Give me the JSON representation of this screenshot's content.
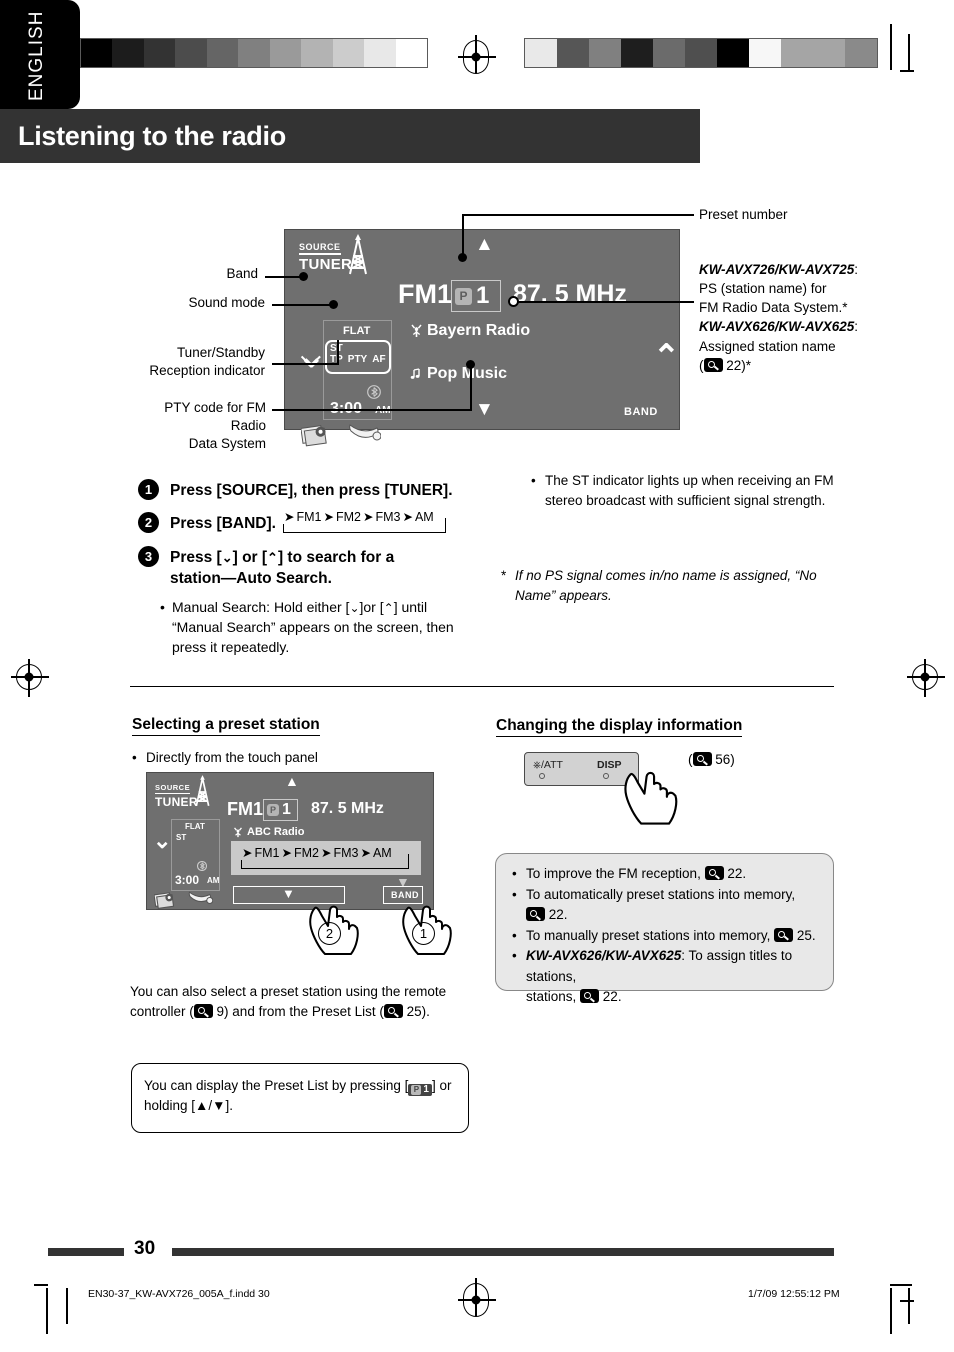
{
  "page": {
    "language_tab": "ENGLISH",
    "title": "Listening to the radio",
    "page_number": "30",
    "footer_file": "EN30-37_KW-AVX726_005A_f.indd   30",
    "footer_date": "1/7/09   12:55:12 PM"
  },
  "display_panel_main": {
    "source_top": "SOURCE",
    "source_bottom": "TUNER",
    "band": "FM1",
    "preset_letter": "P",
    "preset_number": "1",
    "frequency": "87. 5 MHz",
    "ps_name": "Bayern Radio",
    "pty_name": "Pop Music",
    "sound_mode": "FLAT",
    "st_indicator": "ST",
    "tp_indicator": "TP",
    "pty_indicator": "PTY",
    "af_indicator": "AF",
    "clock_time": "3:00",
    "clock_ampm": "AM",
    "band_button": "BAND"
  },
  "callouts_left": [
    {
      "label": "Band"
    },
    {
      "label": "Sound mode"
    },
    {
      "label": "Tuner/Standby\nReception indicator"
    },
    {
      "label": "PTY code for FM Radio\nData System"
    }
  ],
  "callouts_right": {
    "preset_number": "Preset number",
    "ps_model_a": "KW-AVX726/KW-AVX725",
    "ps_desc_a_line1": "PS (station name) for",
    "ps_desc_a_line2": "FM Radio Data System.*",
    "ps_model_b": "KW-AVX626/KW-AVX625",
    "ps_desc_b": "Assigned station name",
    "ps_ref_open": "(",
    "ps_ref_page": "22)*"
  },
  "steps": [
    {
      "num": "1",
      "text": "Press [SOURCE], then press [TUNER]."
    },
    {
      "num": "2",
      "text": "Press [BAND]."
    },
    {
      "num": "3",
      "text": "Press [⌄] or [⌃] to search for a station—Auto Search."
    }
  ],
  "step3_sub": "Manual Search: Hold either [⌄]or [⌃] until “Manual Search” appears on the screen, then press it repeatedly.",
  "band_sequence": [
    "FM1",
    "FM2",
    "FM3",
    "AM"
  ],
  "notes_right": {
    "st_note": "The ST indicator lights up when receiving an FM stereo broadcast with sufficient signal strength.",
    "footnote": "If no PS signal comes in/no name is assigned, “No Name” appears."
  },
  "section_preset": {
    "heading": "Selecting a preset station",
    "bullet": "Directly from the touch panel",
    "panel": {
      "source_top": "SOURCE",
      "source_bottom": "TUNER",
      "band": "FM1",
      "preset_letter": "P",
      "preset_number": "1",
      "frequency": "87. 5 MHz",
      "station_name": "ABC Radio",
      "sound_mode": "FLAT",
      "st_indicator": "ST",
      "clock_time": "3:00",
      "clock_ampm": "AM",
      "band_button": "BAND",
      "band_sequence": [
        "FM1",
        "FM2",
        "FM3",
        "AM"
      ],
      "touch_marker_1": "1",
      "touch_marker_2": "2"
    },
    "paragraph_pre": "You can also select a preset station using the remote controller (",
    "paragraph_mid1": "9) and from the Preset List (",
    "paragraph_end": "25).",
    "tip_pre": "You can display the Preset List by pressing [",
    "tip_post": "] or holding [▲/▼]."
  },
  "section_display": {
    "heading": "Changing the display information",
    "faceplate_left": "/ATT",
    "faceplate_right": "DISP",
    "ref_open": "(",
    "ref_page": "56)"
  },
  "tip_box_items": [
    {
      "pre": "To improve the FM reception, ",
      "page": "22."
    },
    {
      "pre": "To automatically preset stations into memory,",
      "page": "22."
    },
    {
      "pre": "To manually preset stations into memory, ",
      "page": "25."
    },
    {
      "model": "KW-AVX626/KW-AVX625",
      "pre": ": To assign titles to stations, ",
      "page": "22."
    }
  ],
  "colors": {
    "panel_bg": "#6f6f6f",
    "title_bar": "#333333",
    "tab_bg": "#000000",
    "tip_box_bg": "#e8e8e8"
  },
  "calbar_left": [
    "#000000",
    "#1c1c1c",
    "#333333",
    "#4c4c4c",
    "#656565",
    "#808080",
    "#9a9a9a",
    "#b3b3b3",
    "#cccccc",
    "#e8e8e8",
    "#ffffff"
  ],
  "calbar_right": [
    "#e9e9e9",
    "#565656",
    "#808080",
    "#1e1e1e",
    "#6b6b6b",
    "#4f4f4f",
    "#000000",
    "#f7f7f7",
    "#a5a5a5",
    "#a5a5a5",
    "#8a8a8a"
  ]
}
